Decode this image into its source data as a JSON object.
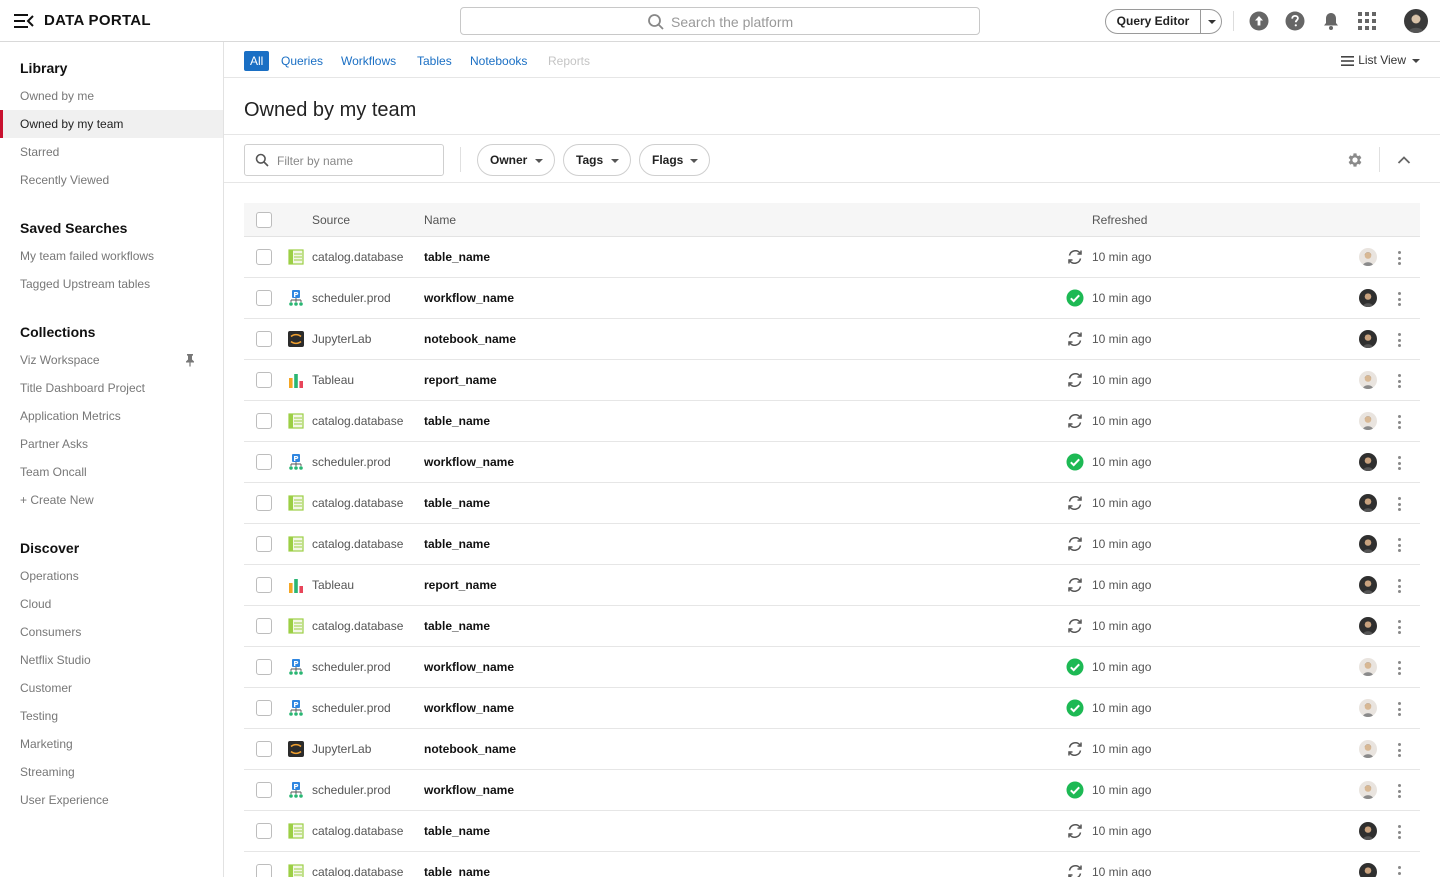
{
  "header": {
    "title": "DATA PORTAL",
    "search_placeholder": "Search the platform",
    "query_editor_label": "Query Editor"
  },
  "sidebar": {
    "library": {
      "heading": "Library",
      "items": [
        {
          "label": "Owned by me"
        },
        {
          "label": "Owned by my team",
          "active": true
        },
        {
          "label": "Starred"
        },
        {
          "label": "Recently Viewed"
        }
      ]
    },
    "saved_searches": {
      "heading": "Saved Searches",
      "items": [
        {
          "label": "My team failed workflows"
        },
        {
          "label": "Tagged Upstream tables"
        }
      ]
    },
    "collections": {
      "heading": "Collections",
      "items": [
        {
          "label": "Viz Workspace",
          "pinned": true
        },
        {
          "label": "Title Dashboard Project"
        },
        {
          "label": "Application Metrics"
        },
        {
          "label": "Partner Asks"
        },
        {
          "label": "Team Oncall"
        },
        {
          "label": "+ Create New"
        }
      ]
    },
    "discover": {
      "heading": "Discover",
      "items": [
        {
          "label": "Operations"
        },
        {
          "label": "Cloud"
        },
        {
          "label": "Consumers"
        },
        {
          "label": "Netflix Studio"
        },
        {
          "label": "Customer"
        },
        {
          "label": "Testing"
        },
        {
          "label": "Marketing"
        },
        {
          "label": "Streaming"
        },
        {
          "label": "User Experience"
        }
      ]
    }
  },
  "tabs": [
    {
      "label": "All",
      "state": "active"
    },
    {
      "label": "Queries",
      "state": "normal"
    },
    {
      "label": "Workflows",
      "state": "normal"
    },
    {
      "label": "Tables",
      "state": "normal"
    },
    {
      "label": "Notebooks",
      "state": "normal"
    },
    {
      "label": "Reports",
      "state": "disabled"
    }
  ],
  "view_selector": {
    "label": "List View"
  },
  "page_title": "Owned by my team",
  "filters": {
    "name_placeholder": "Filter by name",
    "pills": [
      "Owner",
      "Tags",
      "Flags"
    ]
  },
  "table": {
    "columns": {
      "source": "Source",
      "name": "Name",
      "refreshed": "Refreshed"
    },
    "rows": [
      {
        "source": "catalog.database",
        "type": "table",
        "name": "table_name",
        "status": "refresh",
        "refreshed": "10 min ago",
        "avatar": "light"
      },
      {
        "source": "scheduler.prod",
        "type": "workflow",
        "name": "workflow_name",
        "status": "success",
        "refreshed": "10 min ago",
        "avatar": "dark"
      },
      {
        "source": "JupyterLab",
        "type": "notebook",
        "name": "notebook_name",
        "status": "refresh",
        "refreshed": "10 min ago",
        "avatar": "dark"
      },
      {
        "source": "Tableau",
        "type": "report",
        "name": "report_name",
        "status": "refresh",
        "refreshed": "10 min ago",
        "avatar": "light"
      },
      {
        "source": "catalog.database",
        "type": "table",
        "name": "table_name",
        "status": "refresh",
        "refreshed": "10 min ago",
        "avatar": "light"
      },
      {
        "source": "scheduler.prod",
        "type": "workflow",
        "name": "workflow_name",
        "status": "success",
        "refreshed": "10 min ago",
        "avatar": "dark"
      },
      {
        "source": "catalog.database",
        "type": "table",
        "name": "table_name",
        "status": "refresh",
        "refreshed": "10 min ago",
        "avatar": "dark"
      },
      {
        "source": "catalog.database",
        "type": "table",
        "name": "table_name",
        "status": "refresh",
        "refreshed": "10 min ago",
        "avatar": "dark"
      },
      {
        "source": "Tableau",
        "type": "report",
        "name": "report_name",
        "status": "refresh",
        "refreshed": "10 min ago",
        "avatar": "dark"
      },
      {
        "source": "catalog.database",
        "type": "table",
        "name": "table_name",
        "status": "refresh",
        "refreshed": "10 min ago",
        "avatar": "dark"
      },
      {
        "source": "scheduler.prod",
        "type": "workflow",
        "name": "workflow_name",
        "status": "success",
        "refreshed": "10 min ago",
        "avatar": "light"
      },
      {
        "source": "scheduler.prod",
        "type": "workflow",
        "name": "workflow_name",
        "status": "success",
        "refreshed": "10 min ago",
        "avatar": "light"
      },
      {
        "source": "JupyterLab",
        "type": "notebook",
        "name": "notebook_name",
        "status": "refresh",
        "refreshed": "10 min ago",
        "avatar": "light"
      },
      {
        "source": "scheduler.prod",
        "type": "workflow",
        "name": "workflow_name",
        "status": "success",
        "refreshed": "10 min ago",
        "avatar": "light"
      },
      {
        "source": "catalog.database",
        "type": "table",
        "name": "table_name",
        "status": "refresh",
        "refreshed": "10 min ago",
        "avatar": "dark"
      },
      {
        "source": "catalog.database",
        "type": "table",
        "name": "table_name",
        "status": "refresh",
        "refreshed": "10 min ago",
        "avatar": "dark"
      }
    ]
  },
  "colors": {
    "accent_blue": "#1a6fc4",
    "active_marker_red": "#c8102e",
    "success_green": "#1db954",
    "icon_gray": "#666666"
  },
  "icons": {
    "menu": "menu-collapse-icon",
    "search": "search-icon",
    "upload": "upload-icon",
    "help": "help-icon",
    "notifications": "bell-icon",
    "apps": "apps-grid-icon",
    "pin": "pin-icon",
    "settings": "gear-icon",
    "collapse": "chevron-up-icon",
    "list_view": "list-view-icon",
    "refresh": "refresh-icon",
    "success": "check-circle-icon",
    "more": "more-vertical-icon"
  }
}
